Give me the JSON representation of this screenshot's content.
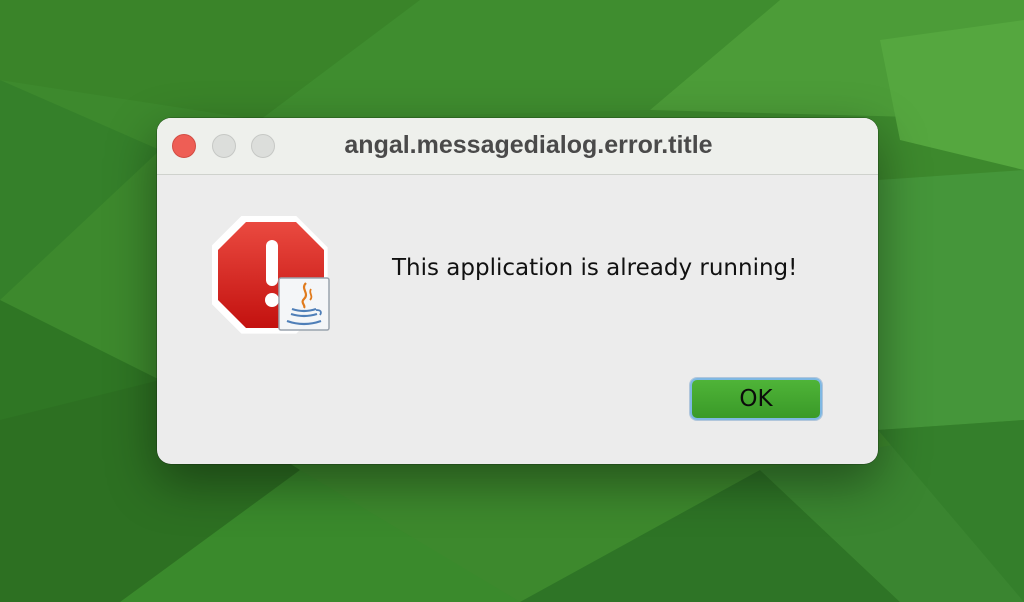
{
  "window": {
    "title": "angal.messagedialog.error.title"
  },
  "dialog": {
    "message": "This application is already running!",
    "ok_label": "OK"
  },
  "colors": {
    "desktop_green": "#3f8a2e",
    "close_red": "#ee5e55",
    "ok_green": "#3a9a28",
    "stop_red": "#cf1f1f"
  },
  "icons": {
    "alert": "stop-sign-exclamation-icon",
    "java": "java-coffee-cup-icon"
  }
}
